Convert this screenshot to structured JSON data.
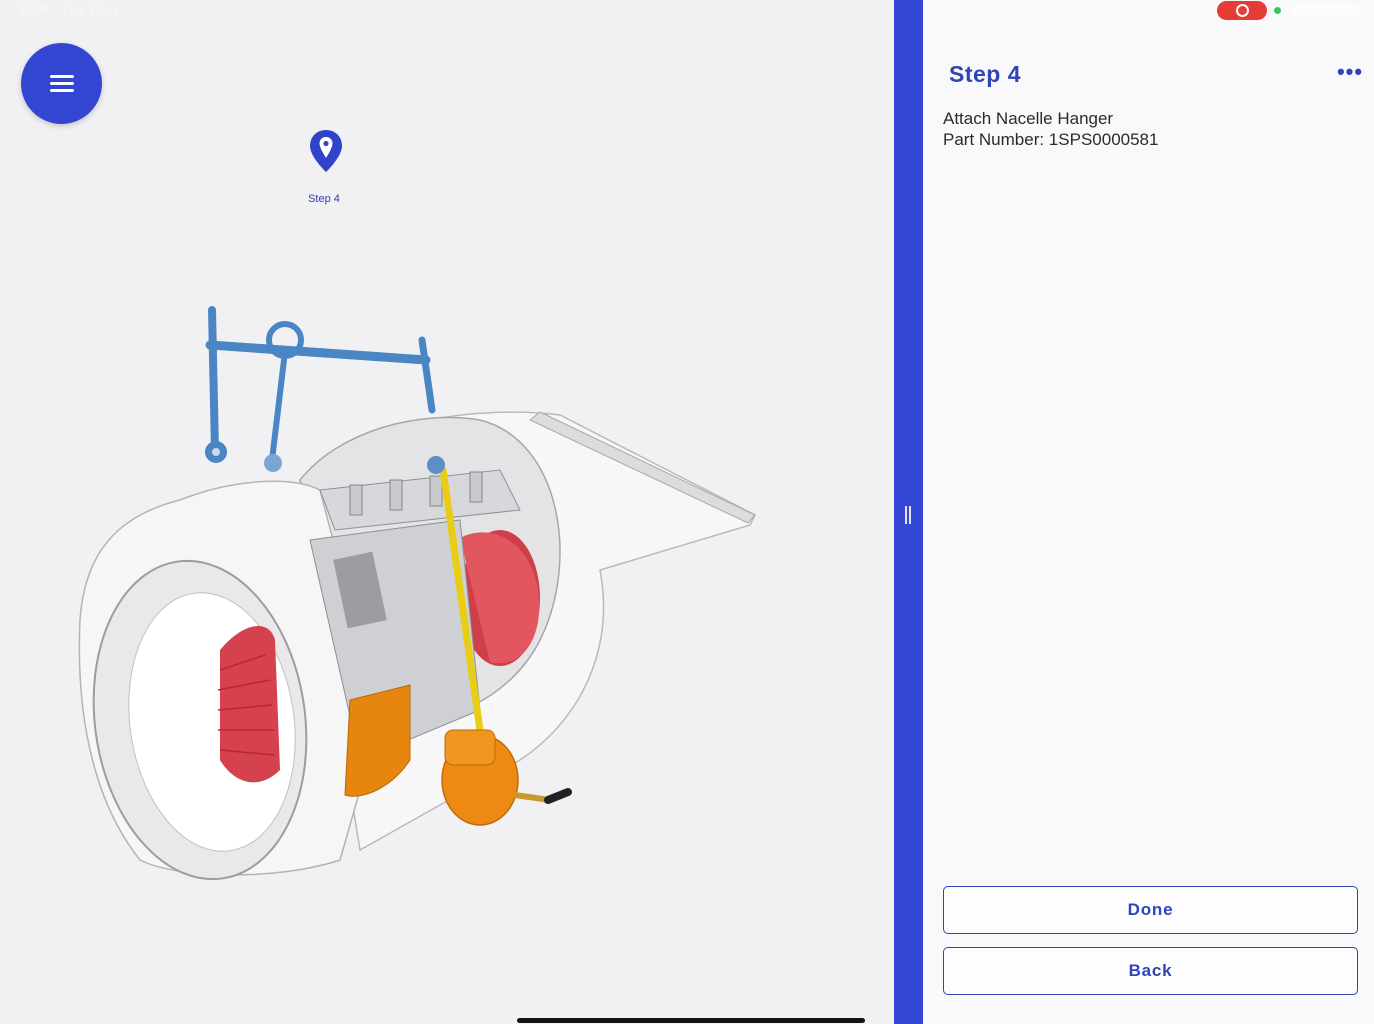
{
  "statusbar": {
    "time": "10:08",
    "date": "Tue 3 Jun"
  },
  "viewport": {
    "marker": {
      "label": "Step 4",
      "icon": "location-pin-icon"
    },
    "model": {
      "name": "jet-engine-nacelle-3d-model"
    }
  },
  "panel": {
    "title": "Step 4",
    "more_icon": "ellipsis-icon",
    "more_label": "•••",
    "description_line1": "Attach Nacelle Hanger",
    "description_line2": "Part Number: 1SPS0000581",
    "buttons": {
      "done": "Done",
      "back": "Back"
    }
  },
  "colors": {
    "accent": "#3346d2",
    "panel_text": "#2f44b7",
    "record": "#e53d36",
    "fan_red": "#d9454f",
    "hanger_blue": "#4a86c4",
    "tool_orange": "#ef8a14",
    "rod_yellow": "#f0d018"
  }
}
